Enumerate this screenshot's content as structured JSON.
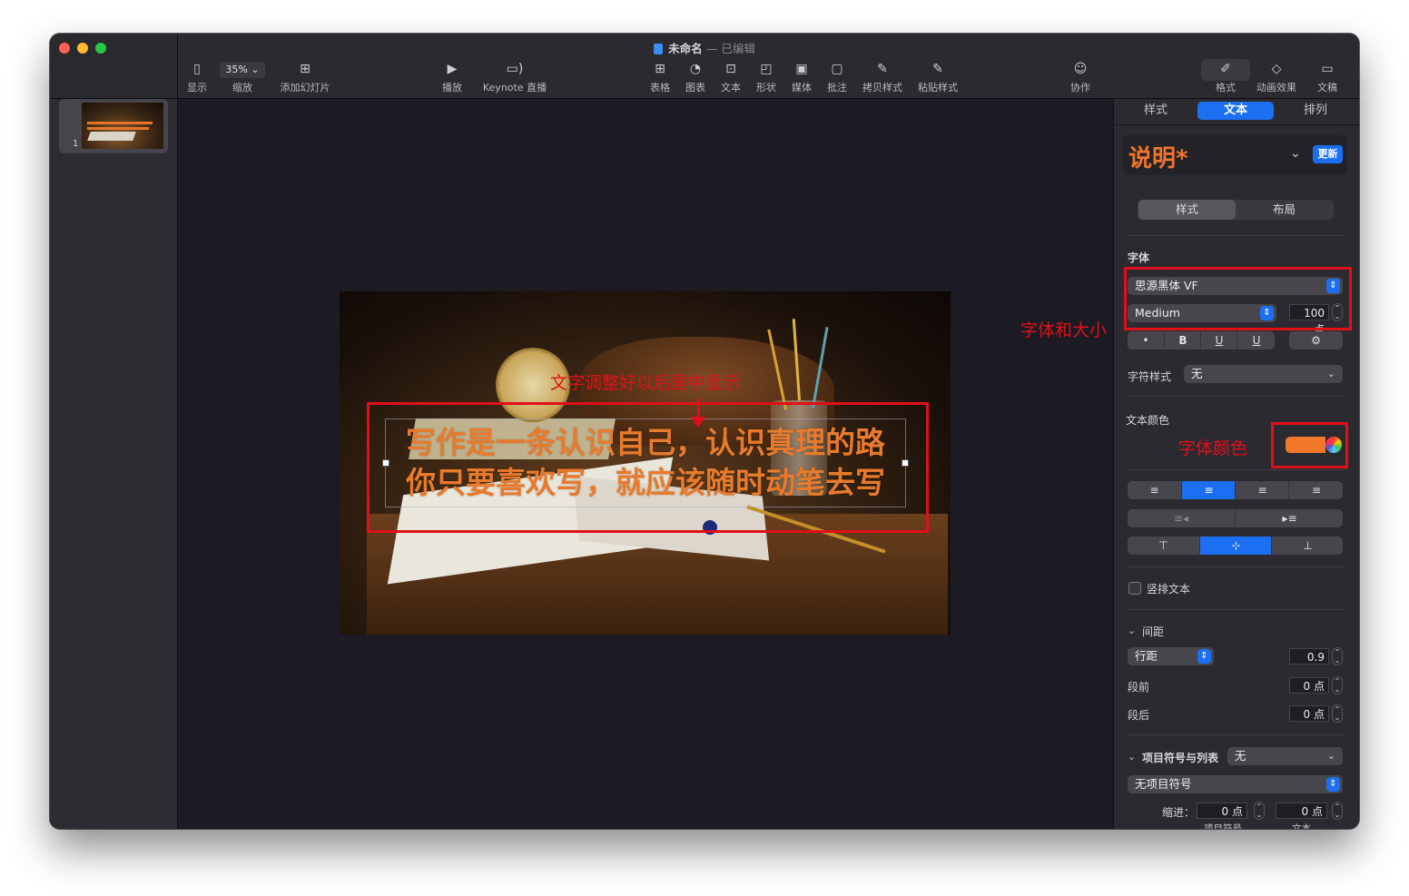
{
  "window": {
    "title": "未命名",
    "title_status": "— 已编辑"
  },
  "toolbar": {
    "view_label": "显示",
    "zoom_value": "35%",
    "zoom_label": "缩放",
    "add_slide_label": "添加幻灯片",
    "play_label": "播放",
    "keynote_live_label": "Keynote 直播",
    "table_label": "表格",
    "chart_label": "图表",
    "text_label": "文本",
    "shape_label": "形状",
    "media_label": "媒体",
    "comment_label": "批注",
    "copy_style_label": "拷贝样式",
    "paste_style_label": "粘贴样式",
    "collaborate_label": "协作",
    "format_label": "格式",
    "animate_label": "动画效果",
    "document_label": "文稿"
  },
  "slides": [
    {
      "number": "1"
    }
  ],
  "slide": {
    "text_line_1": "写作是一条认识自己，认识真理的路",
    "text_line_2": "你只要喜欢写，就应该随时动笔去写",
    "text_color": "#e87a2c"
  },
  "annotations": {
    "center_note": "文字调整好以后居中显示",
    "font_note": "字体和大小",
    "color_note": "字体颜色"
  },
  "inspector": {
    "tabs": [
      "样式",
      "文本",
      "排列"
    ],
    "active_tab": "文本",
    "paragraph_style": "说明*",
    "update_button": "更新",
    "subtabs": [
      "样式",
      "布局"
    ],
    "font_section": "字体",
    "font_family": "思源黑体 VF",
    "font_weight": "Medium",
    "font_size": "100 点",
    "char_buttons": [
      "•",
      "B",
      "U",
      "U"
    ],
    "char_style_label": "字符样式",
    "char_style_value": "无",
    "text_color_label": "文本颜色",
    "text_color": "#f07828",
    "vertical_text_label": "竖排文本",
    "spacing_section": "间距",
    "line_spacing_mode": "行距",
    "line_spacing_value": "0.9",
    "before_label": "段前",
    "before_value": "0 点",
    "after_label": "段后",
    "after_value": "0 点",
    "bullets_section": "项目符号与列表",
    "bullets_value": "无",
    "bullet_type": "无项目符号",
    "indent_label": "缩进：",
    "indent_bullet_value": "0 点",
    "indent_bullet_label": "项目符号",
    "indent_text_value": "0 点",
    "indent_text_label": "文本"
  },
  "icons": {
    "align_left": "≡",
    "align_center": "≡",
    "align_right": "≡",
    "justify": "≡",
    "indent_decrease": "≡◂",
    "indent_increase": "▸≡",
    "valign_top": "⊤",
    "valign_middle": "⊹",
    "valign_bottom": "⊥",
    "gear": "⚙",
    "chevron_down": "⌄",
    "stepper_up_down": "⌃⌄"
  }
}
